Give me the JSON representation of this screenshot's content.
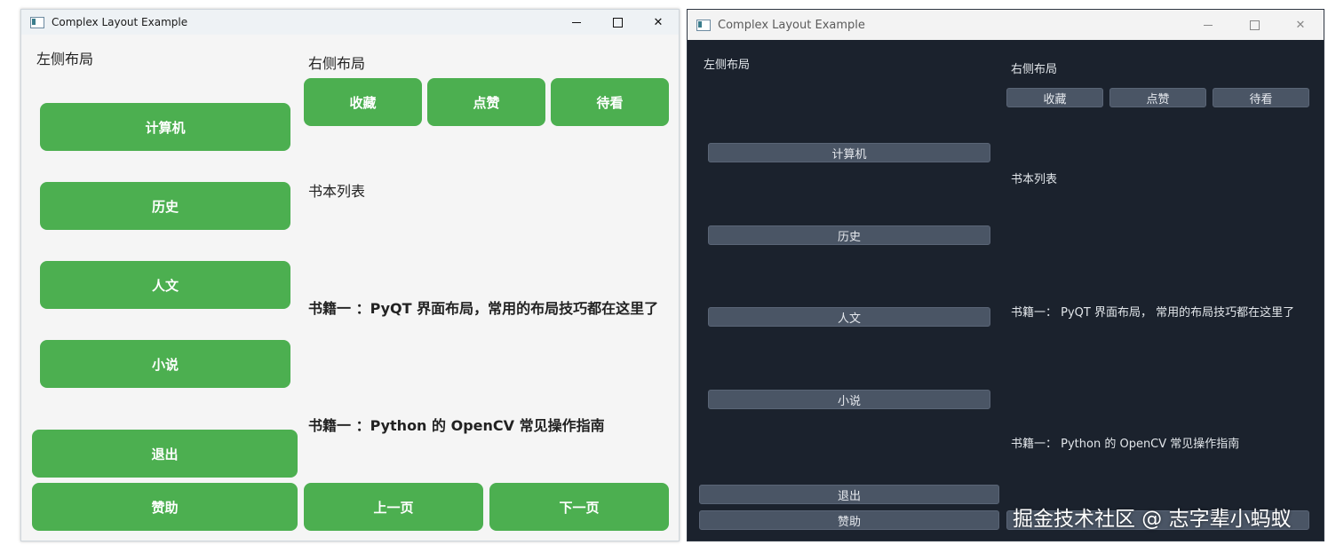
{
  "window_title": "Complex Layout Example",
  "left_layout_label": "左侧布局",
  "right_layout_label": "右侧布局",
  "book_list_label": "书本列表",
  "categories": [
    "计算机",
    "历史",
    "人文",
    "小说"
  ],
  "top_actions": [
    "收藏",
    "点赞",
    "待看"
  ],
  "books": [
    "书籍一 ：PyQT 界面布局，常用的布局技巧都在这里了",
    "书籍一 ：Python 的 OpenCV 常见操作指南"
  ],
  "dark_books": [
    "书籍一： PyQT 界面布局， 常用的布局技巧都在这里了",
    "书籍一： Python 的 OpenCV 常见操作指南"
  ],
  "exit_label": "退出",
  "sponsor_label": "赞助",
  "prev_label": "上一页",
  "next_label": "下一页",
  "watermark": "掘金技术社区 @ 志字辈小蚂蚁",
  "colors": {
    "light_button": "#4caf50",
    "light_bg": "#f5f5f5",
    "dark_bg": "#1b222d",
    "dark_button": "#4a5565"
  },
  "icons": {
    "minimize": "minimize-icon",
    "maximize": "maximize-icon",
    "close": "close-icon",
    "app": "app-icon"
  }
}
